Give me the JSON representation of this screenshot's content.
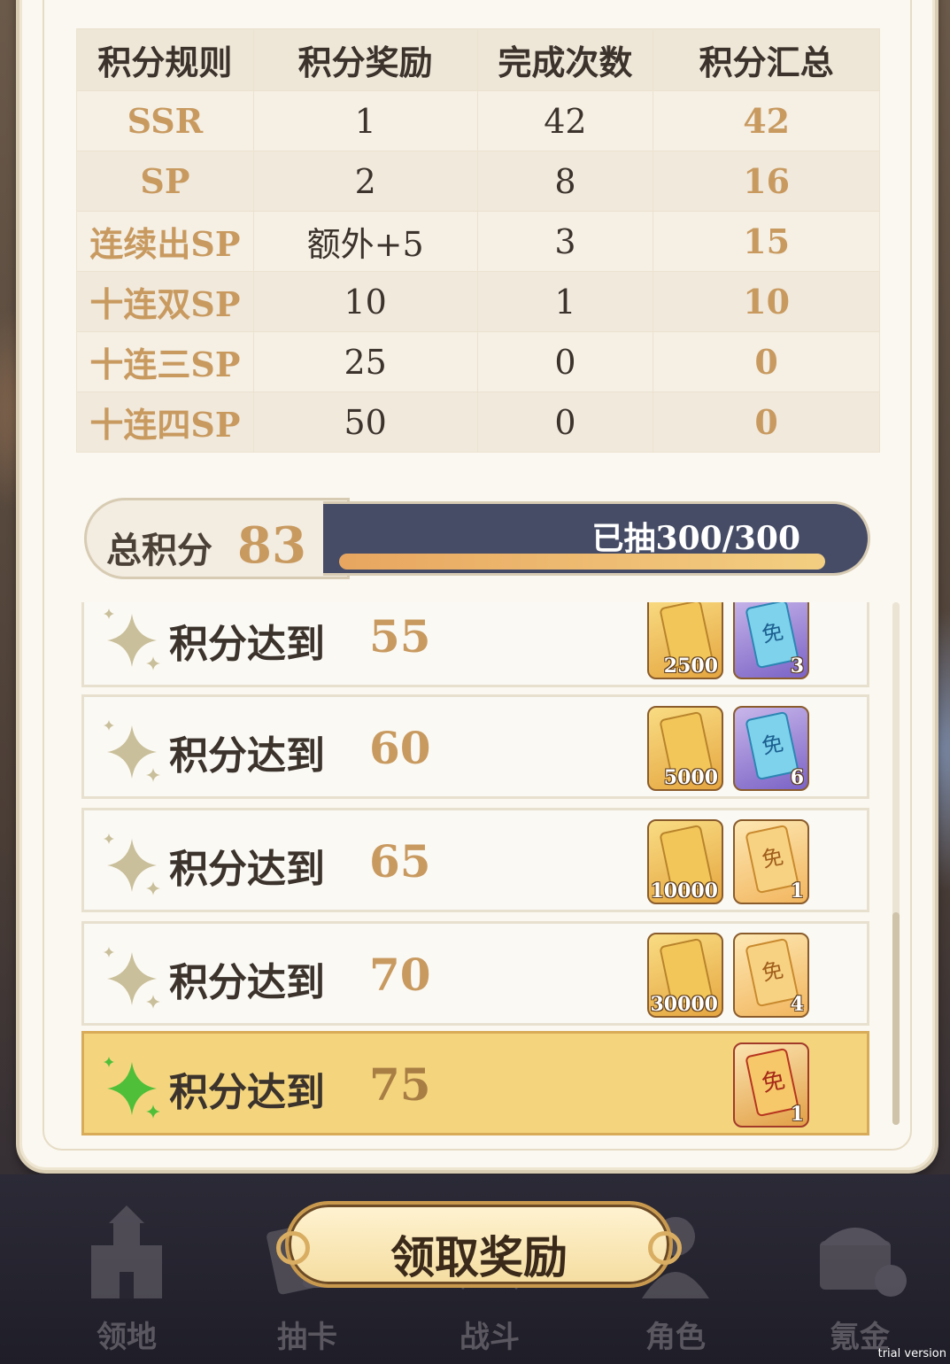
{
  "table": {
    "headers": [
      "积分规则",
      "积分奖励",
      "完成次数",
      "积分汇总"
    ],
    "rows": [
      {
        "rule": "SSR",
        "reward": "1",
        "count": "42",
        "total": "42"
      },
      {
        "rule": "SP",
        "reward": "2",
        "count": "8",
        "total": "16"
      },
      {
        "rule": "连续出SP",
        "reward": "额外+5",
        "count": "3",
        "total": "15"
      },
      {
        "rule": "十连双SP",
        "reward": "10",
        "count": "1",
        "total": "10"
      },
      {
        "rule": "十连三SP",
        "reward": "25",
        "count": "0",
        "total": "0"
      },
      {
        "rule": "十连四SP",
        "reward": "50",
        "count": "0",
        "total": "0"
      }
    ]
  },
  "summary": {
    "total_label": "总积分",
    "total_value": "83",
    "draw_text": "已抽300/300",
    "draw_progress": 1.0
  },
  "milestones": [
    {
      "label": "积分达到",
      "score": "55",
      "active": false,
      "rewards": [
        {
          "kind": "gold",
          "icon": "coin-card-icon",
          "qty": "2500"
        },
        {
          "kind": "blue",
          "icon": "free-ticket-icon",
          "glyph": "免",
          "qty": "3"
        }
      ]
    },
    {
      "label": "积分达到",
      "score": "60",
      "active": false,
      "rewards": [
        {
          "kind": "gold",
          "icon": "coin-card-icon",
          "qty": "5000"
        },
        {
          "kind": "blue",
          "icon": "free-ticket-icon",
          "glyph": "免",
          "qty": "6"
        }
      ]
    },
    {
      "label": "积分达到",
      "score": "65",
      "active": false,
      "rewards": [
        {
          "kind": "gold",
          "icon": "coin-card-icon",
          "qty": "10000"
        },
        {
          "kind": "ticket",
          "icon": "free-ticket-icon",
          "glyph": "免",
          "qty": "1"
        }
      ]
    },
    {
      "label": "积分达到",
      "score": "70",
      "active": false,
      "rewards": [
        {
          "kind": "gold",
          "icon": "coin-card-icon",
          "qty": "30000"
        },
        {
          "kind": "ticket",
          "icon": "free-ticket-icon",
          "glyph": "免",
          "qty": "4"
        }
      ]
    },
    {
      "label": "积分达到",
      "score": "75",
      "active": true,
      "rewards": [
        {
          "kind": "red",
          "icon": "free-ticket-icon",
          "glyph": "免",
          "qty": "1"
        }
      ]
    }
  ],
  "claim_button": "领取奖励",
  "nav": [
    {
      "label": "领地",
      "icon": "castle-icon"
    },
    {
      "label": "抽卡",
      "icon": "cards-icon"
    },
    {
      "label": "战斗",
      "icon": "sword-icon"
    },
    {
      "label": "角色",
      "icon": "character-icon"
    },
    {
      "label": "氪金",
      "icon": "treasure-icon"
    }
  ],
  "watermark": "trial version",
  "colors": {
    "accent_gold": "#c89a60",
    "panel_bg": "#fbf8f1",
    "progress_bar_bg": "#464c66",
    "active_row": "#f4d57e"
  }
}
